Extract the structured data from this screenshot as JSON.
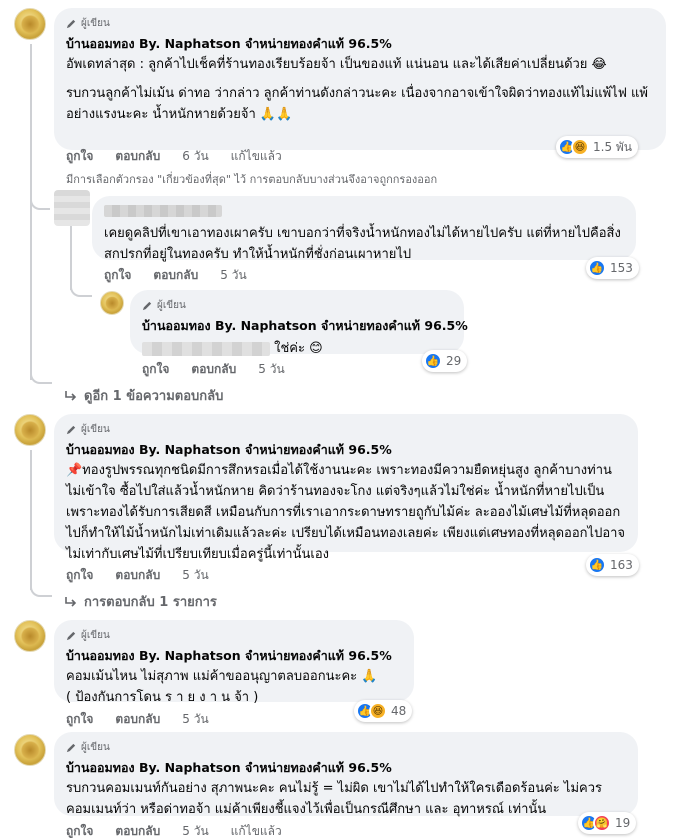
{
  "comments": [
    {
      "author_badge": "ผู้เขียน",
      "name": "บ้านออมทอง By. Naphatson จำหน่ายทองคำแท้ 96.5%",
      "paragraphs": [
        "อัพเดทล่าสุด : ลูกค้าไปเช็คที่ร้านทองเรียบร้อยจ้า เป็นของแท้ แน่นอน และได้เสียค่าเปลี่ยนด้วย 😂",
        "รบกวนลูกค้าไม่เม้น ด่าทอ ว่ากล่าว ลูกค้าท่านดังกล่าวนะคะ เนื่องจากอาจเข้าใจผิดว่าทองแท้ไม่แพ้ไฟ แพ้อย่างแรงนะคะ น้ำหนักหายด้วยจ้า 🙏🙏"
      ],
      "actions": {
        "like": "ถูกใจ",
        "reply": "ตอบกลับ",
        "time": "6 วัน",
        "edited": "แก้ไขแล้ว"
      },
      "reactions": {
        "count": "1.5 พัน"
      }
    },
    {
      "paragraphs": [
        "เคยดูคลิปที่เขาเอาทองเผาครับ เขาบอกว่าที่จริงน้ำหนักทองไม่ได้หายไปครับ แต่ที่หายไปคือสิ่งสกปรกที่อยู่ในทองครับ ทำให้น้ำหนักที่ชั่งก่อนเผาหายไป"
      ],
      "actions": {
        "like": "ถูกใจ",
        "reply": "ตอบกลับ",
        "time": "5 วัน"
      },
      "reactions": {
        "count": "153"
      }
    },
    {
      "author_badge": "ผู้เขียน",
      "name": "บ้านออมทอง By. Naphatson จำหน่ายทองคำแท้ 96.5%",
      "text": "ใช่ค่ะ 😊",
      "actions": {
        "like": "ถูกใจ",
        "reply": "ตอบกลับ",
        "time": "5 วัน"
      },
      "reactions": {
        "count": "29"
      }
    },
    {
      "author_badge": "ผู้เขียน",
      "name": "บ้านออมทอง By. Naphatson จำหน่ายทองคำแท้ 96.5%",
      "paragraphs": [
        "📌ทองรูปพรรณทุกชนิดมีการสึกหรอเมื่อได้ใช้งานนะคะ เพราะทองมีความยืดหยุ่นสูง ลูกค้าบางท่านไม่เข้าใจ ซื้อไปใส่แล้วน้ำหนักหาย คิดว่าร้านทองจะโกง แต่จริงๆแล้วไม่ใช่ค่ะ น้ำหนักที่หายไปเป็นเพราะทองได้รับการเสียดสี เหมือนกับการที่เราเอากระดาษทรายถูกับไม้ค่ะ ละอองไม้เศษไม้ที่หลุดออกไปก็ทำให้ไม้น้ำหนักไม่เท่าเดิมแล้วละค่ะ เปรียบได้เหมือนทองเลยค่ะ เพียงแต่เศษทองที่หลุดออกไปอาจไม่เท่ากับเศษไม้ที่เปรียบเทียบเมื่อครู่นี้เท่านั้นเอง"
      ],
      "actions": {
        "like": "ถูกใจ",
        "reply": "ตอบกลับ",
        "time": "5 วัน"
      },
      "reactions": {
        "count": "163"
      }
    },
    {
      "author_badge": "ผู้เขียน",
      "name": "บ้านออมทอง By. Naphatson จำหน่ายทองคำแท้ 96.5%",
      "paragraphs": [
        "คอมเม้นไหน ไม่สุภาพ แม่ค้าขออนุญาตลบออกนะคะ 🙏",
        "( ป้องกันการโดน ร า ย ง า น จ้า )"
      ],
      "actions": {
        "like": "ถูกใจ",
        "reply": "ตอบกลับ",
        "time": "5 วัน"
      },
      "reactions": {
        "count": "48"
      }
    },
    {
      "author_badge": "ผู้เขียน",
      "name": "บ้านออมทอง By. Naphatson จำหน่ายทองคำแท้ 96.5%",
      "paragraphs": [
        "รบกวนคอมเมนท์กันอย่าง สุภาพนะคะ คนไม่รู้ = ไม่ผิด เขาไม่ได้ไปทำให้ใครเดือดร้อนค่ะ ไม่ควรคอมเมนท์ว่า หรือด่าทอจ้า แม่ค้าเพียงชี้แจงไว้เพื่อเป็นกรณีศึกษา และ อุทาหรณ์ เท่านั้น"
      ],
      "actions": {
        "like": "ถูกใจ",
        "reply": "ตอบกลับ",
        "time": "5 วัน",
        "edited": "แก้ไขแล้ว"
      },
      "reactions": {
        "count": "19"
      }
    }
  ],
  "filter_note": "มีการเลือกตัวกรอง \"เกี่ยวข้องที่สุด\" ไว้ การตอบกลับบางส่วนจึงอาจถูกกรองออก",
  "see_more_replies": "ดูอีก 1 ข้อความตอบกลับ",
  "replies_link": "การตอบกลับ 1 รายการ"
}
